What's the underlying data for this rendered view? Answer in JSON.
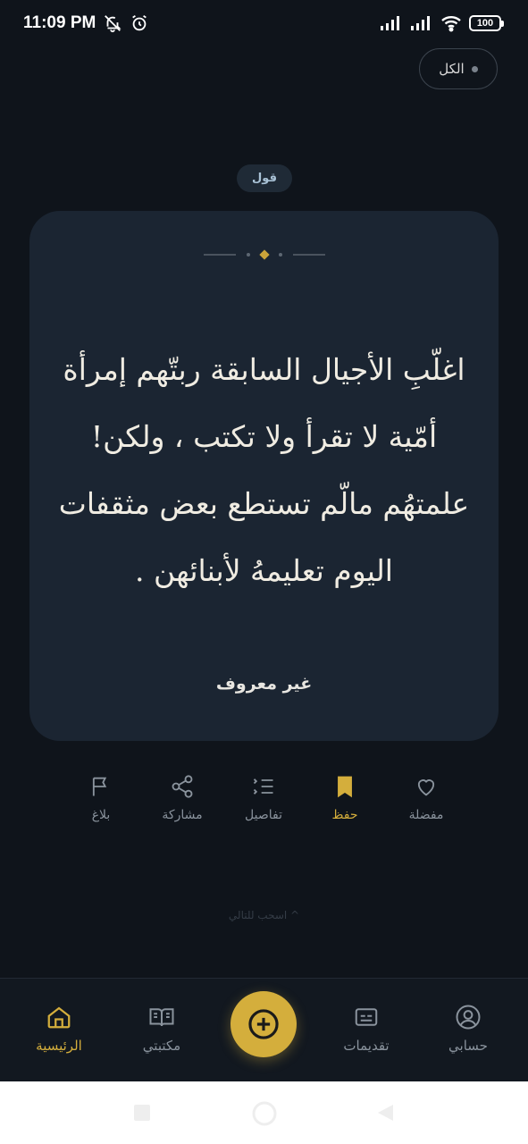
{
  "status": {
    "time": "11:09 PM",
    "battery": "100"
  },
  "filter": {
    "label": "الكل"
  },
  "quote": {
    "type_badge": "قول",
    "lines": [
      "اغلّبِ الأجيال السابقة ربتّهم إمرأة",
      "أمّية لا تقرأ ولا تكتب ، ولكن!",
      "علمتهُم مالّم تستطع بعض مثقفات",
      "اليوم تعليمهُ لأبنائهن ."
    ],
    "author": "غير معروف"
  },
  "actions": [
    {
      "label": "مفضلة",
      "icon": "heart-icon",
      "active": false
    },
    {
      "label": "حفظ",
      "icon": "bookmark-icon",
      "active": true
    },
    {
      "label": "تفاصيل",
      "icon": "list-details-icon",
      "active": false
    },
    {
      "label": "مشاركة",
      "icon": "share-icon",
      "active": false
    },
    {
      "label": "بلاغ",
      "icon": "flag-icon",
      "active": false
    }
  ],
  "swipe_hint": "^ اسحب للتالي",
  "bottom_nav": {
    "account": "حسابي",
    "submissions": "تقديمات",
    "library": "مكتبتي",
    "home": "الرئيسية"
  },
  "colors": {
    "accent": "#d4ae3c",
    "background": "#0f141b",
    "card": "#1b2532"
  }
}
